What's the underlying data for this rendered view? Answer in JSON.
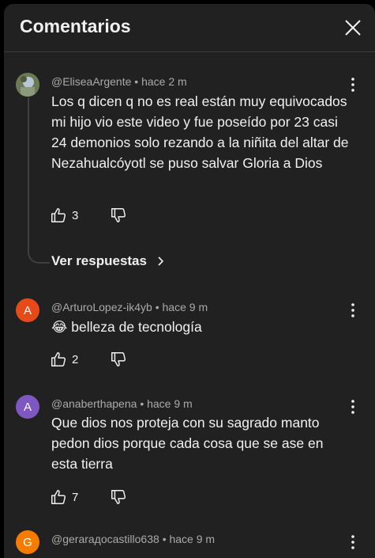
{
  "header": {
    "title": "Comentarios"
  },
  "comments": [
    {
      "author": "@EliseaArgente",
      "time": "hace 2 m",
      "text": "Los q dicen q no es real están muy equivocados mi hijo vio este video y fue poseído por 23 casi 24 demonios solo rezando a la niñita del altar de Nezahualcóyotl se puso salvar Gloria a Dios",
      "likes": "3",
      "replies_label": "Ver respuestas",
      "avatar_letter": ""
    },
    {
      "author": "@ArturoLopez-ik4yb",
      "time": "hace 9 m",
      "text": "😂 belleza de tecnología",
      "likes": "2",
      "avatar_letter": "A",
      "avatar_color": "#e64a19"
    },
    {
      "author": "@anaberthapena",
      "time": "hace 9 m",
      "text": "Que dios nos proteja  con su sagrado manto pedon dios porque cada cosa que se ase en esta tierra",
      "likes": "7",
      "avatar_letter": "A",
      "avatar_color": "#7e57c2"
    },
    {
      "author": "@gerarадocastillo638",
      "time": "hace 9 m",
      "avatar_letter": "G",
      "avatar_color": "#f57c00"
    }
  ],
  "separator": "•"
}
